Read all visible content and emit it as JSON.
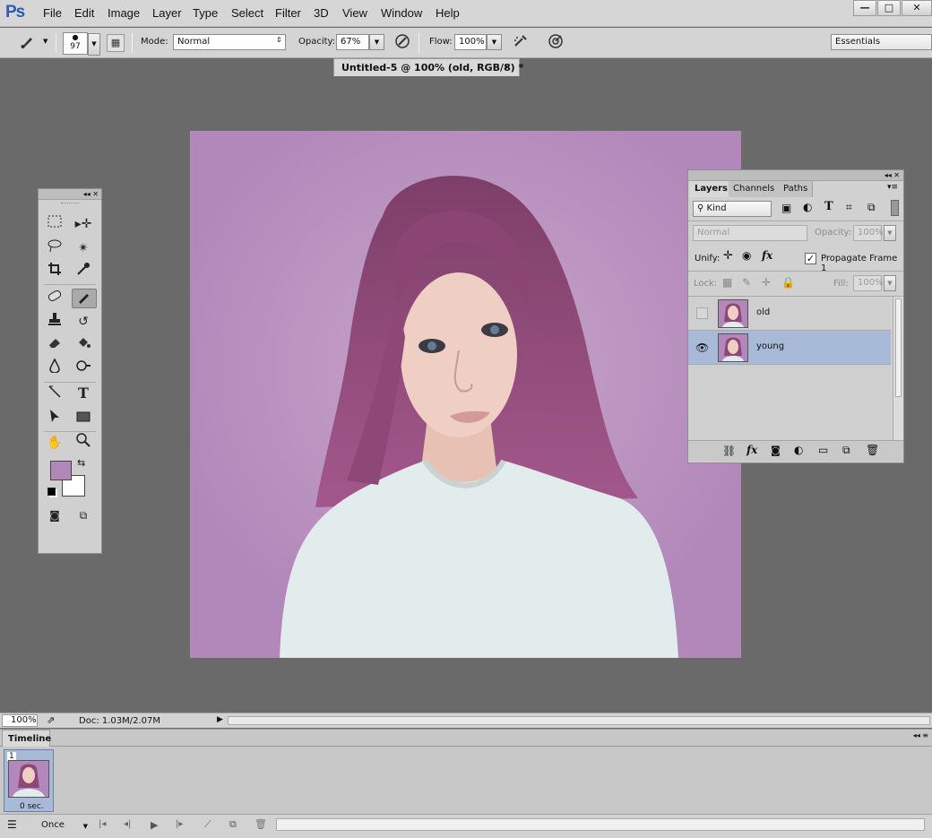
{
  "app": {
    "logo": "Ps"
  },
  "menu": [
    "File",
    "Edit",
    "Image",
    "Layer",
    "Type",
    "Select",
    "Filter",
    "3D",
    "View",
    "Window",
    "Help"
  ],
  "window_controls": {
    "minimize": "—",
    "maximize": "□",
    "close": "✕"
  },
  "options_bar": {
    "brush_size": "97",
    "mode_label": "Mode:",
    "mode_value": "Normal",
    "opacity_label": "Opacity:",
    "opacity_value": "67%",
    "flow_label": "Flow:",
    "flow_value": "100%",
    "workspace": "Essentials"
  },
  "document_tab": {
    "title": "Untitled-5 @ 100% (old, RGB/8) *",
    "close": "×"
  },
  "tools": {
    "foreground_color": "#b287ba",
    "background_color": "#ffffff"
  },
  "layers_panel": {
    "tabs": [
      "Layers",
      "Channels",
      "Paths"
    ],
    "filter_kind": "Kind",
    "blend_mode": "Normal",
    "opacity_label": "Opacity:",
    "opacity_value": "100%",
    "unify_label": "Unify:",
    "propagate_label": "Propagate Frame 1",
    "propagate_checked": true,
    "lock_label": "Lock:",
    "fill_label": "Fill:",
    "fill_value": "100%",
    "layers": [
      {
        "name": "old",
        "visible": false,
        "selected": false
      },
      {
        "name": "young",
        "visible": true,
        "selected": true
      }
    ]
  },
  "status_bar": {
    "zoom": "100%",
    "doc": "Doc: 1.03M/2.07M"
  },
  "timeline": {
    "tab": "Timeline",
    "frames": [
      {
        "number": "1",
        "delay": "0 sec."
      }
    ],
    "loop": "Once"
  },
  "colors": {
    "canvas_background": "#b287ba",
    "selection_blue": "#a9b9d8"
  }
}
